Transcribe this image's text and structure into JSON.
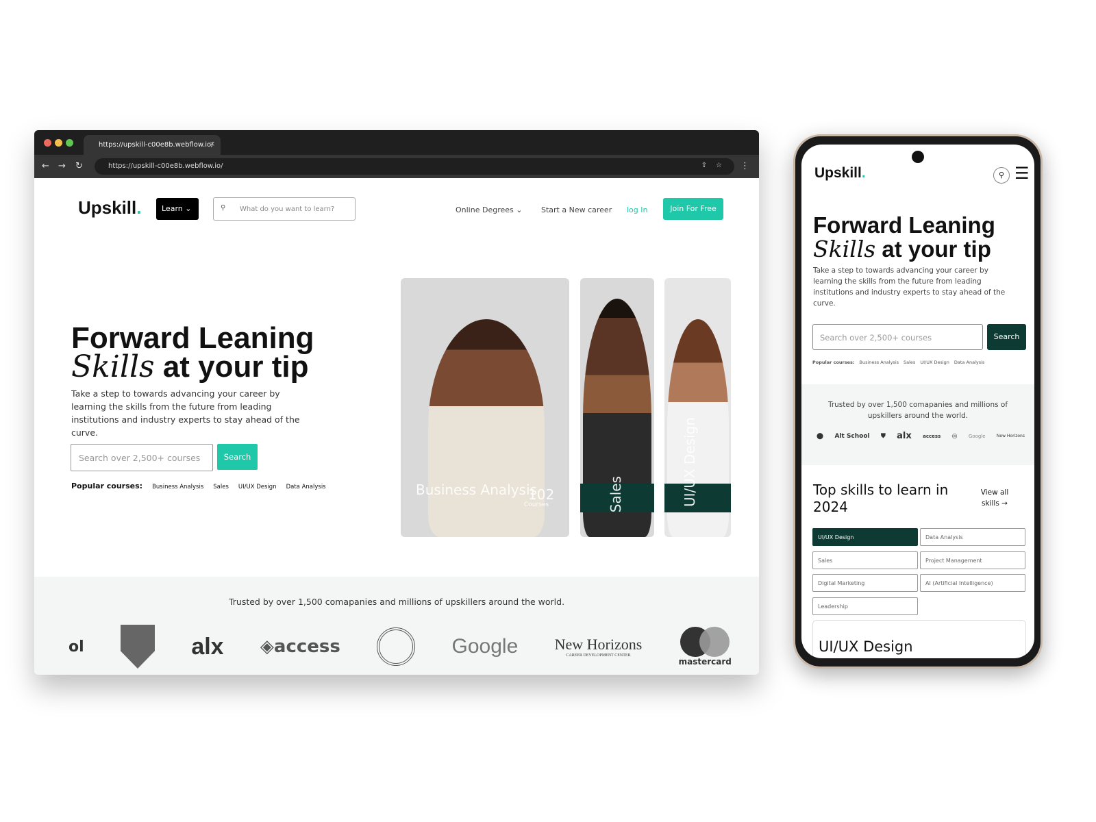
{
  "browser": {
    "tab_title": "https://upskill-c00e8b.webflow.io/",
    "url": "https://upskill-c00e8b.webflow.io/",
    "traffic_colors": [
      "#ec6a5e",
      "#f4bf4f",
      "#61c554"
    ]
  },
  "site": {
    "logo": "Upskill",
    "logo_dot": ".",
    "learn_label": "Learn",
    "search_placeholder": "What do you want to learn?",
    "nav": [
      "Online Degrees",
      "Start a New career",
      "log In"
    ],
    "join_label": "Join For Free",
    "accent": "#1fc8a8",
    "dark": "#0d3b34"
  },
  "hero": {
    "title_line1": "Forward Leaning",
    "title_em": "Skills",
    "title_rest": " at your tip",
    "description": "Take a step to towards advancing your career by learning the skills from the future from leading institutions and industry experts to stay ahead of the curve.",
    "search_placeholder": "Search over 2,500+ courses",
    "search_button": "Search",
    "popular_label": "Popular courses:",
    "popular": [
      "Business Analysis",
      "Sales",
      "UI/UX Design",
      "Data Analysis"
    ],
    "cards": [
      {
        "label": "Business Analysis",
        "count": "102",
        "count_label": "Courses"
      },
      {
        "label": "Sales"
      },
      {
        "label": "UI/UX Design"
      }
    ]
  },
  "trust": {
    "text": "Trusted by over 1,500 comapanies and millions of upskillers around the world.",
    "logos": [
      "ol",
      "shield-crest",
      "alx",
      "access",
      "university-seal",
      "Google",
      "New Horizons",
      "mastercard"
    ],
    "new_horizons_sub": "CAREER DEVELOPMENT CENTER",
    "mobile_logos": [
      "mastercard",
      "Alt School",
      "shield-crest",
      "alx",
      "access",
      "university-seal",
      "Google",
      "New Horizons"
    ]
  },
  "mobile": {
    "skills_title": "Top skills to learn in 2024",
    "view_all": "View all skills",
    "chips": [
      "UI/UX Design",
      "Data Analysis",
      "Sales",
      "Project Management",
      "Digital Marketing",
      "AI (Artificial Intelligence)",
      "Leadership"
    ],
    "active_chip": "UI/UX Design",
    "card_title": "UI/UX Design"
  }
}
